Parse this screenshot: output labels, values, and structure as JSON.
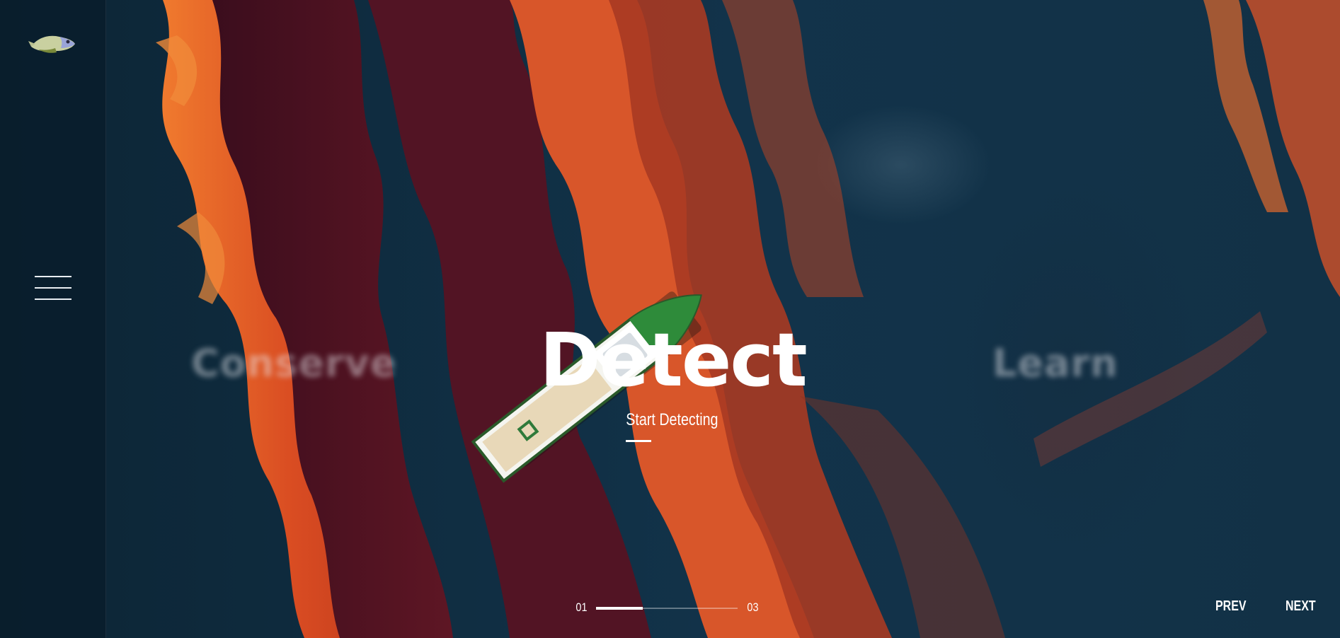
{
  "brand": {
    "logo_icon": "fish-icon"
  },
  "menu": {
    "icon": "hamburger-menu-icon"
  },
  "slides": {
    "previous": "Conserve",
    "current": "Detect",
    "next": "Learn"
  },
  "cta": {
    "label": "Start Detecting"
  },
  "pagination": {
    "current": "01",
    "total": "03",
    "progress": 0.33
  },
  "controls": {
    "prev_label": "PREV",
    "next_label": "NEXT"
  },
  "colors": {
    "background": "#0c2535",
    "oil_orange": "#e8622a",
    "oil_dark": "#4a1220",
    "text": "#ffffff"
  }
}
